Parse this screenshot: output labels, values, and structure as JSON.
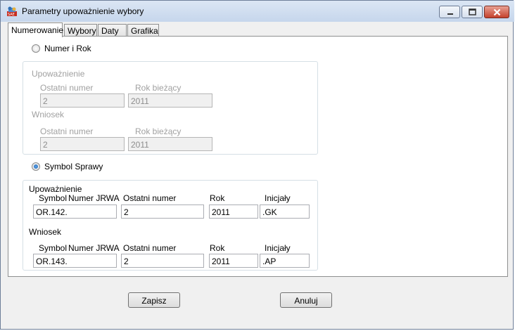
{
  "window": {
    "title": "Parametry upoważnienie wybory",
    "icon": "app-icon"
  },
  "title_controls": {
    "minimize_icon": "minimize-icon",
    "maximize_icon": "maximize-icon",
    "close_icon": "close-icon"
  },
  "tabs": [
    {
      "label": "Numerowanie",
      "active": true
    },
    {
      "label": "Wybory",
      "active": false
    },
    {
      "label": "Daty",
      "active": false
    },
    {
      "label": "Grafika",
      "active": false
    }
  ],
  "option_numer_rok": {
    "label": "Numer i Rok",
    "checked": false,
    "upowaznienie": {
      "title": "Upoważnienie",
      "ostatni_label": "Ostatni numer",
      "rok_label": "Rok bieżący",
      "ostatni_value": "2",
      "rok_value": "2011"
    },
    "wniosek": {
      "title": "Wniosek",
      "ostatni_label": "Ostatni numer",
      "rok_label": "Rok bieżący",
      "ostatni_value": "2",
      "rok_value": "2011"
    }
  },
  "option_symbol": {
    "label": "Symbol Sprawy",
    "checked": true,
    "upowaznienie": {
      "title": "Upoważnienie",
      "symbol_label": "Symbol",
      "jrwa_label": "Numer JRWA",
      "ostatni_label": "Ostatni numer",
      "rok_label": "Rok",
      "inicjaly_label": "Inicjały",
      "symbol_value": "OR.142.",
      "ostatni_value": "2",
      "rok_value": "2011",
      "inicjaly_value": ".GK"
    },
    "wniosek": {
      "title": "Wniosek",
      "symbol_label": "Symbol",
      "jrwa_label": "Numer JRWA",
      "ostatni_label": "Ostatni numer",
      "rok_label": "Rok",
      "inicjaly_label": "Inicjały",
      "symbol_value": "OR.143.",
      "ostatni_value": "2",
      "rok_value": "2011",
      "inicjaly_value": ".AP"
    }
  },
  "buttons": {
    "save": "Zapisz",
    "cancel": "Anuluj"
  }
}
